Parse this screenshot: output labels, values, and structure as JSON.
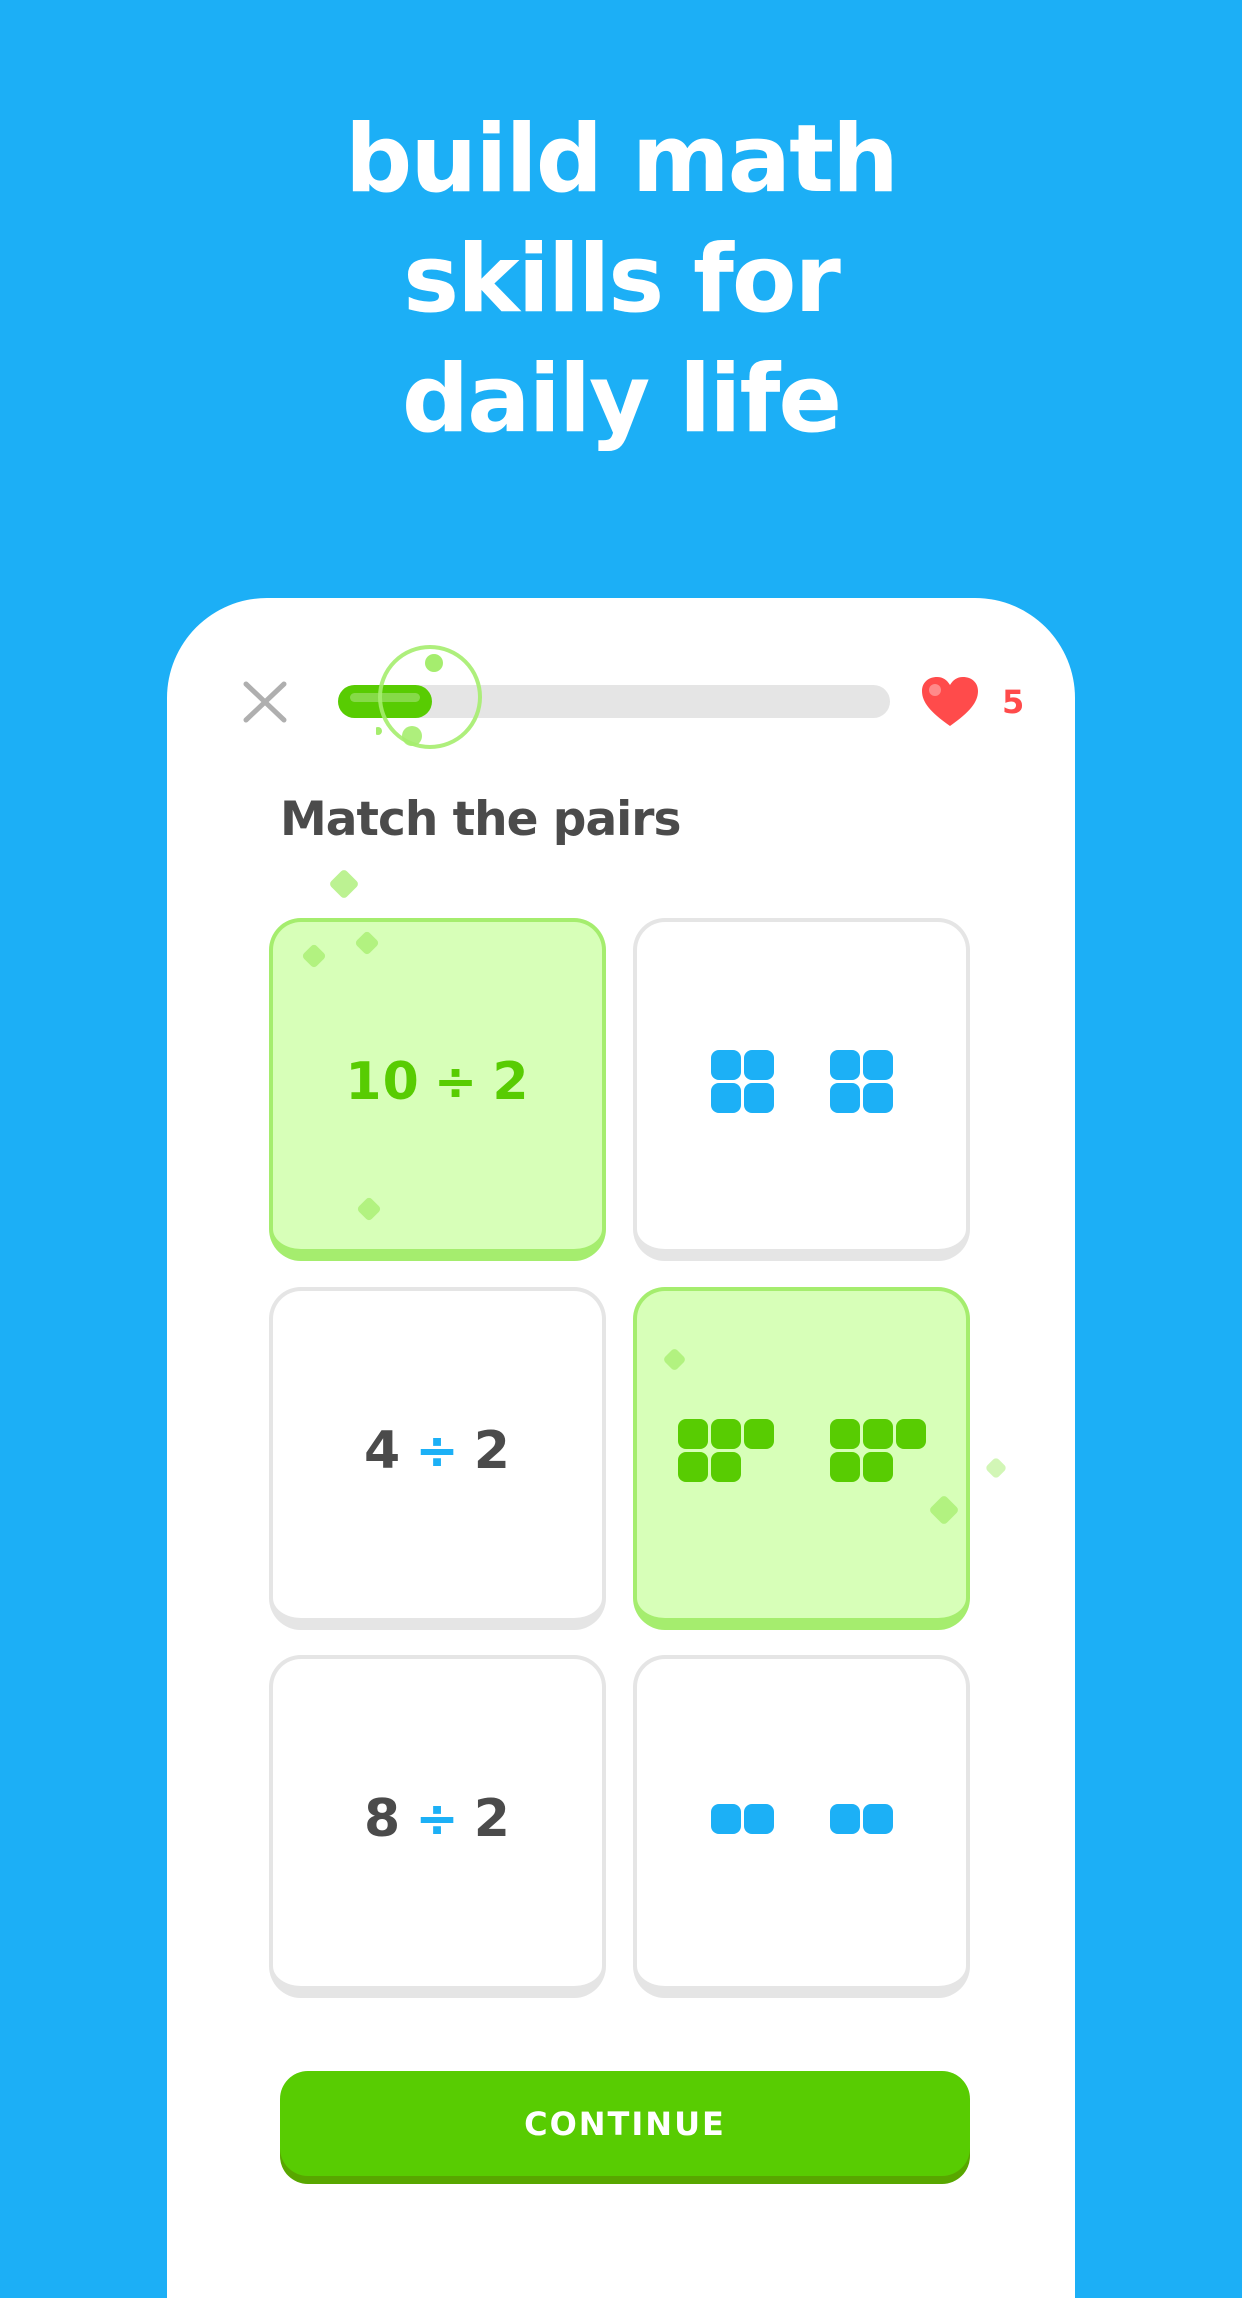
{
  "headline": {
    "lines": [
      "build math",
      "skills for",
      "daily life"
    ]
  },
  "lesson": {
    "close_icon": "close-icon",
    "progress": {
      "fraction": 0.17
    },
    "hearts": {
      "icon": "heart-icon",
      "count": "5"
    },
    "prompt": "Match the pairs",
    "tiles": [
      {
        "type": "expression",
        "left": "10",
        "operator": "÷",
        "right": "2",
        "state": "matched"
      },
      {
        "type": "blocks",
        "color": "blue",
        "groups": [
          [
            1,
            1,
            1,
            1
          ],
          [
            1,
            1,
            1,
            1
          ]
        ],
        "columns": 2,
        "state": "default"
      },
      {
        "type": "expression",
        "left": "4",
        "operator": "÷",
        "right": "2",
        "state": "default"
      },
      {
        "type": "blocks",
        "color": "green",
        "groups": [
          [
            1,
            1,
            1,
            1,
            1,
            0
          ],
          [
            1,
            1,
            1,
            1,
            1,
            0
          ]
        ],
        "columns": 3,
        "state": "matched"
      },
      {
        "type": "expression",
        "left": "8",
        "operator": "÷",
        "right": "2",
        "state": "default"
      },
      {
        "type": "blocks",
        "color": "blue",
        "groups": [
          [
            1,
            1
          ],
          [
            1,
            1
          ]
        ],
        "columns": 2,
        "state": "default"
      }
    ],
    "continue_label": "CONTINUE"
  },
  "colors": {
    "background": "#1CAFF6",
    "accent_green": "#58CC02",
    "matched_fill": "#D7FFB8",
    "matched_border": "#A5ED6E",
    "heart_red": "#FF4B4B",
    "block_blue": "#1CB0F6",
    "text_dark": "#4B4B4B"
  }
}
